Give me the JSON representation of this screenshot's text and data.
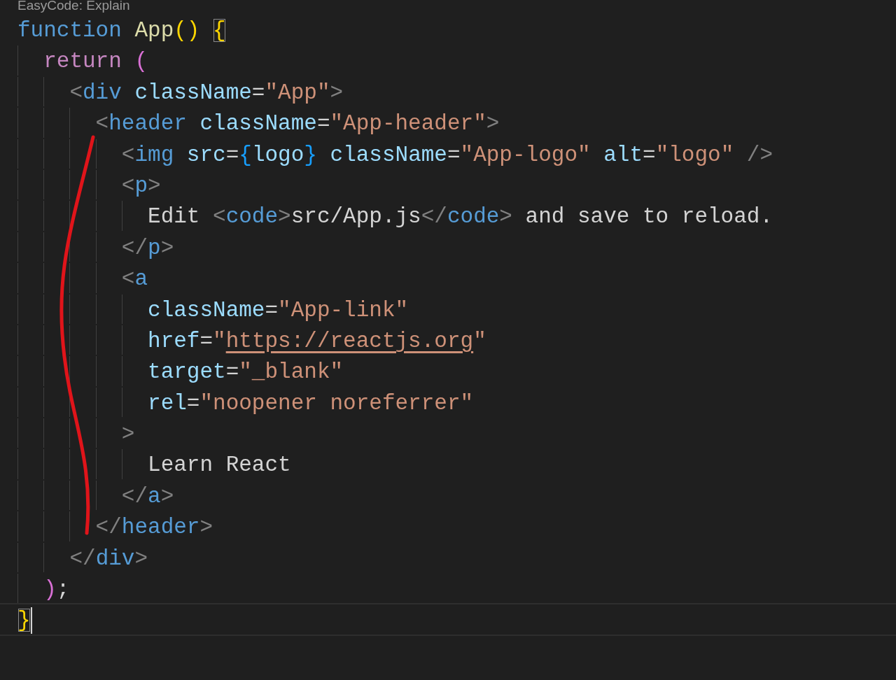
{
  "codelens": "EasyCode: Explain",
  "lines": [
    {
      "current": false,
      "tokens": [
        {
          "text": "function",
          "kind": "keyword"
        },
        {
          "text": " App",
          "kind": "func"
        },
        {
          "text": "() ",
          "kind": "b1"
        },
        {
          "text": "{",
          "kind": "b1",
          "matched": true
        }
      ]
    },
    {
      "current": false,
      "tokens": [
        {
          "text": "  return",
          "kind": "control"
        },
        {
          "text": " (",
          "kind": "b2"
        }
      ]
    },
    {
      "current": false,
      "tokens": [
        {
          "text": "    <",
          "kind": "punct"
        },
        {
          "text": "div",
          "kind": "tag"
        },
        {
          "text": " className",
          "kind": "attr"
        },
        {
          "text": "=",
          "kind": "text"
        },
        {
          "text": "\"App\"",
          "kind": "string"
        },
        {
          "text": ">",
          "kind": "punct"
        }
      ]
    },
    {
      "current": false,
      "tokens": [
        {
          "text": "      <",
          "kind": "punct"
        },
        {
          "text": "header",
          "kind": "tag"
        },
        {
          "text": " className",
          "kind": "attr"
        },
        {
          "text": "=",
          "kind": "text"
        },
        {
          "text": "\"App-header\"",
          "kind": "string"
        },
        {
          "text": ">",
          "kind": "punct"
        }
      ]
    },
    {
      "current": false,
      "tokens": [
        {
          "text": "        <",
          "kind": "punct"
        },
        {
          "text": "img",
          "kind": "tag"
        },
        {
          "text": " src",
          "kind": "attr"
        },
        {
          "text": "=",
          "kind": "text"
        },
        {
          "text": "{",
          "kind": "b3"
        },
        {
          "text": "logo",
          "kind": "var"
        },
        {
          "text": "}",
          "kind": "b3"
        },
        {
          "text": " className",
          "kind": "attr"
        },
        {
          "text": "=",
          "kind": "text"
        },
        {
          "text": "\"App-logo\"",
          "kind": "string"
        },
        {
          "text": " alt",
          "kind": "attr"
        },
        {
          "text": "=",
          "kind": "text"
        },
        {
          "text": "\"logo\"",
          "kind": "string"
        },
        {
          "text": " />",
          "kind": "punct"
        }
      ]
    },
    {
      "current": false,
      "tokens": [
        {
          "text": "        <",
          "kind": "punct"
        },
        {
          "text": "p",
          "kind": "tag"
        },
        {
          "text": ">",
          "kind": "punct"
        }
      ]
    },
    {
      "current": false,
      "tokens": [
        {
          "text": "          Edit ",
          "kind": "text"
        },
        {
          "text": "<",
          "kind": "punct"
        },
        {
          "text": "code",
          "kind": "tag"
        },
        {
          "text": ">",
          "kind": "punct"
        },
        {
          "text": "src/App.js",
          "kind": "text"
        },
        {
          "text": "</",
          "kind": "punct"
        },
        {
          "text": "code",
          "kind": "tag"
        },
        {
          "text": ">",
          "kind": "punct"
        },
        {
          "text": " and save to reload.",
          "kind": "text"
        }
      ]
    },
    {
      "current": false,
      "tokens": [
        {
          "text": "        </",
          "kind": "punct"
        },
        {
          "text": "p",
          "kind": "tag"
        },
        {
          "text": ">",
          "kind": "punct"
        }
      ]
    },
    {
      "current": false,
      "tokens": [
        {
          "text": "        <",
          "kind": "punct"
        },
        {
          "text": "a",
          "kind": "tag"
        }
      ]
    },
    {
      "current": false,
      "tokens": [
        {
          "text": "          className",
          "kind": "attr"
        },
        {
          "text": "=",
          "kind": "text"
        },
        {
          "text": "\"App-link\"",
          "kind": "string"
        }
      ]
    },
    {
      "current": false,
      "tokens": [
        {
          "text": "          href",
          "kind": "attr"
        },
        {
          "text": "=",
          "kind": "text"
        },
        {
          "text": "\"",
          "kind": "string"
        },
        {
          "text": "https://reactjs.org",
          "kind": "link"
        },
        {
          "text": "\"",
          "kind": "string"
        }
      ]
    },
    {
      "current": false,
      "tokens": [
        {
          "text": "          target",
          "kind": "attr"
        },
        {
          "text": "=",
          "kind": "text"
        },
        {
          "text": "\"_blank\"",
          "kind": "string"
        }
      ]
    },
    {
      "current": false,
      "tokens": [
        {
          "text": "          rel",
          "kind": "attr"
        },
        {
          "text": "=",
          "kind": "text"
        },
        {
          "text": "\"noopener noreferrer\"",
          "kind": "string"
        }
      ]
    },
    {
      "current": false,
      "tokens": [
        {
          "text": "        >",
          "kind": "punct"
        }
      ]
    },
    {
      "current": false,
      "tokens": [
        {
          "text": "          Learn React",
          "kind": "text"
        }
      ]
    },
    {
      "current": false,
      "tokens": [
        {
          "text": "        </",
          "kind": "punct"
        },
        {
          "text": "a",
          "kind": "tag"
        },
        {
          "text": ">",
          "kind": "punct"
        }
      ]
    },
    {
      "current": false,
      "tokens": [
        {
          "text": "      </",
          "kind": "punct"
        },
        {
          "text": "header",
          "kind": "tag"
        },
        {
          "text": ">",
          "kind": "punct"
        }
      ]
    },
    {
      "current": false,
      "tokens": [
        {
          "text": "    </",
          "kind": "punct"
        },
        {
          "text": "div",
          "kind": "tag"
        },
        {
          "text": ">",
          "kind": "punct"
        }
      ]
    },
    {
      "current": false,
      "tokens": [
        {
          "text": "  )",
          "kind": "b2"
        },
        {
          "text": ";",
          "kind": "text"
        }
      ]
    },
    {
      "current": true,
      "tokens": [
        {
          "text": "}",
          "kind": "b1",
          "matched": true
        }
      ]
    }
  ]
}
